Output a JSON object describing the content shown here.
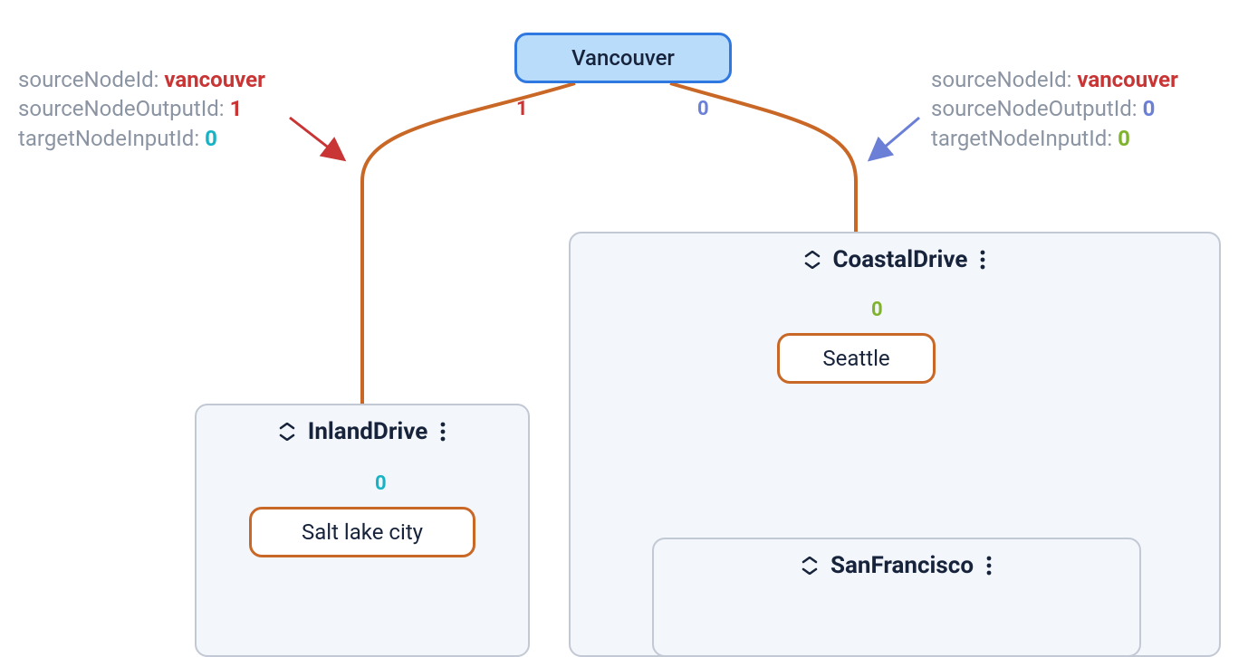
{
  "nodes": {
    "root": {
      "id": "vancouver",
      "label": "Vancouver"
    },
    "inland_child": {
      "label": "Salt lake city"
    },
    "coastal_child": {
      "label": "Seattle"
    }
  },
  "groups": {
    "inland": {
      "title": "InlandDrive"
    },
    "coastal": {
      "title": "CoastalDrive"
    },
    "sanfrancisco": {
      "title": "SanFrancisco"
    }
  },
  "ports": {
    "root_out_left": "1",
    "root_out_right": "0",
    "inland_in": "0",
    "coastal_in": "0"
  },
  "annotations": {
    "left": {
      "sourceNodeId": {
        "label": "sourceNodeId:",
        "value": "vancouver",
        "color": "red"
      },
      "sourceNodeOutputId": {
        "label": "sourceNodeOutputId:",
        "value": "1",
        "color": "red"
      },
      "targetNodeInputId": {
        "label": "targetNodeInputId:",
        "value": "0",
        "color": "teal"
      }
    },
    "right": {
      "sourceNodeId": {
        "label": "sourceNodeId:",
        "value": "vancouver",
        "color": "red"
      },
      "sourceNodeOutputId": {
        "label": "sourceNodeOutputId:",
        "value": "0",
        "color": "blue"
      },
      "targetNodeInputId": {
        "label": "targetNodeInputId:",
        "value": "0",
        "color": "green"
      }
    }
  },
  "colors": {
    "edge_orange": "#c96826",
    "edge_gray": "#8b94a3",
    "arrow_red": "#c93434",
    "arrow_blue": "#6b7fd6"
  }
}
